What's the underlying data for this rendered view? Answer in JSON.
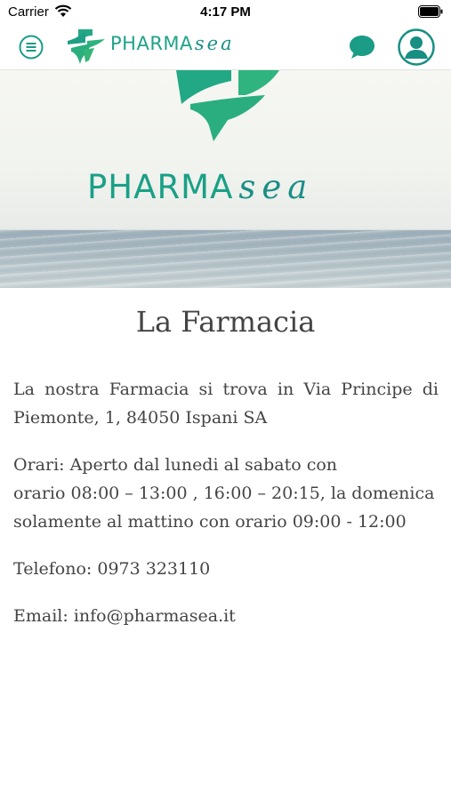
{
  "status_bar": {
    "carrier": "Carrier",
    "time": "4:17 PM"
  },
  "header": {
    "logo": {
      "brand": "PHARMA",
      "brand_script": "sea"
    },
    "icons": {
      "menu": "menu-icon",
      "chat": "chat-bubble-icon",
      "profile": "user-profile-icon"
    }
  },
  "hero": {
    "brand": "PHARMA",
    "brand_script": "sea"
  },
  "page": {
    "title": "La Farmacia",
    "address": "La nostra Farmacia si trova in Via Principe di Piemonte, 1, 84050 Ispani SA",
    "hours_line1": "Orari:  Aperto dal lunedi al sabato con",
    "hours_line2": "orario  08:00 – 13:00 , 16:00 – 20:15, la domenica solamente al mattino con orario 09:00 - 12:00",
    "phone": "Telefono: 0973 323110",
    "email": "Email: info@pharmasea.it"
  },
  "colors": {
    "accent": "#1fa38a",
    "accent_dark": "#1a8f86"
  }
}
